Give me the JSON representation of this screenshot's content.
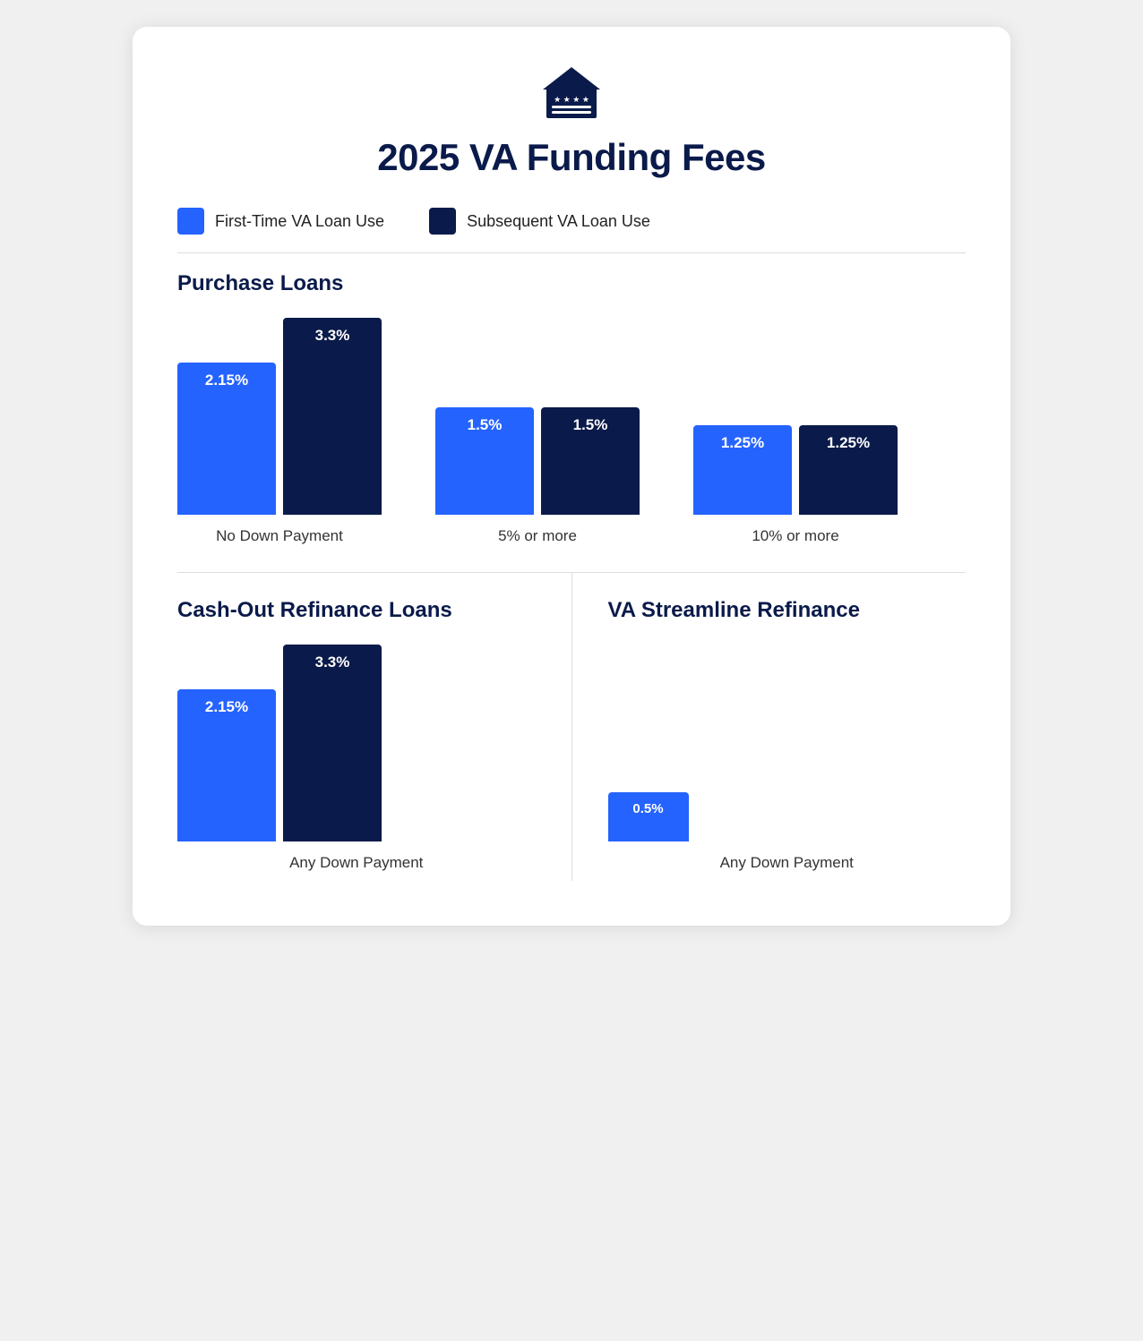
{
  "header": {
    "title": "2025 VA Funding Fees"
  },
  "legend": {
    "first_label": "First-Time VA Loan Use",
    "subsequent_label": "Subsequent VA Loan Use"
  },
  "purchase": {
    "section_title": "Purchase Loans",
    "groups": [
      {
        "label": "No Down Payment",
        "first_pct": "2.15%",
        "first_height": 170,
        "subsequent_pct": "3.3%",
        "subsequent_height": 220
      },
      {
        "label": "5% or more",
        "first_pct": "1.5%",
        "first_height": 120,
        "subsequent_pct": "1.5%",
        "subsequent_height": 120
      },
      {
        "label": "10% or more",
        "first_pct": "1.25%",
        "first_height": 100,
        "subsequent_pct": "1.25%",
        "subsequent_height": 100
      }
    ]
  },
  "cash_out": {
    "section_title": "Cash-Out Refinance Loans",
    "label": "Any Down Payment",
    "first_pct": "2.15%",
    "first_height": 170,
    "subsequent_pct": "3.3%",
    "subsequent_height": 220
  },
  "streamline": {
    "section_title": "VA Streamline Refinance",
    "label": "Any Down Payment",
    "first_pct": "0.5%",
    "first_height": 55
  },
  "colors": {
    "first": "#2563ff",
    "subsequent": "#0a1a4a",
    "title": "#0a1a4a"
  }
}
